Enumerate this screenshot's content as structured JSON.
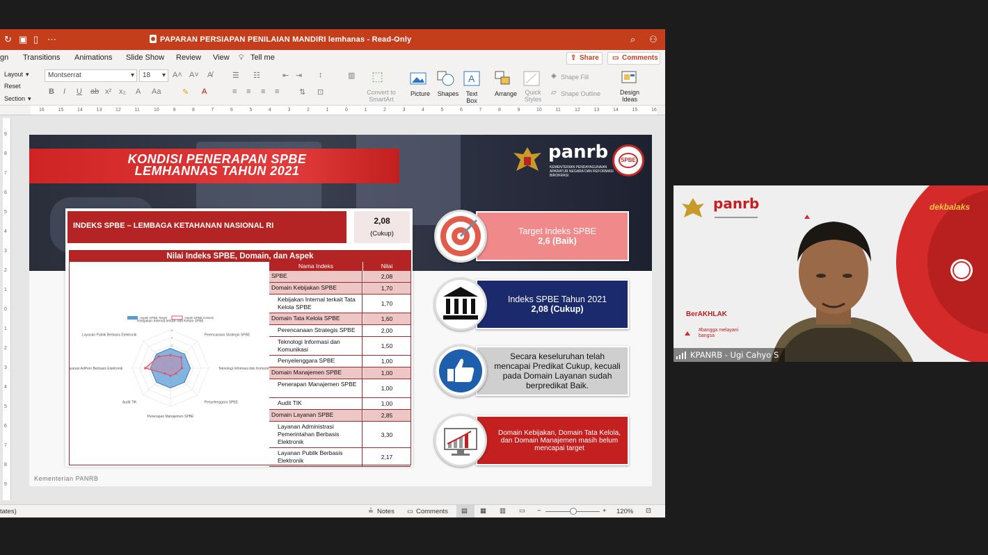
{
  "window": {
    "title": "PAPARAN PERSIAPAN PENILAIAN MANDIRI lemhanas - Read-Only",
    "share_label": "Share",
    "comments_label": "Comments"
  },
  "menu": [
    "gn",
    "Transitions",
    "Animations",
    "Slide Show",
    "Review",
    "View",
    "Tell me"
  ],
  "ribbon": {
    "layout_label": "Layout",
    "reset_label": "Reset",
    "section_label": "Section",
    "font_name": "Montserrat",
    "font_size": "18",
    "convert_label_1": "Convert to",
    "convert_label_2": "SmartArt",
    "picture_label": "Picture",
    "shapes_label": "Shapes",
    "textbox_label_1": "Text",
    "textbox_label_2": "Box",
    "arrange_label": "Arrange",
    "quick_styles_1": "Quick",
    "quick_styles_2": "Styles",
    "shape_fill_label": "Shape Fill",
    "shape_outline_label": "Shape Outline",
    "design_ideas_1": "Design",
    "design_ideas_2": "Ideas"
  },
  "ruler_ticks": [
    "16",
    "15",
    "14",
    "13",
    "12",
    "11",
    "10",
    "9",
    "8",
    "7",
    "6",
    "5",
    "4",
    "3",
    "2",
    "1",
    "0",
    "1",
    "2",
    "3",
    "4",
    "5",
    "6",
    "7",
    "8",
    "9",
    "10",
    "11",
    "12",
    "13",
    "14",
    "15",
    "16"
  ],
  "vruler_ticks": [
    "9",
    "8",
    "7",
    "6",
    "5",
    "4",
    "3",
    "2",
    "1",
    "0",
    "1",
    "2",
    "3",
    "4",
    "5",
    "6",
    "7",
    "8",
    "9"
  ],
  "slide": {
    "title_line1": "KONDISI PENERAPAN SPBE",
    "title_line2": "LEMHANNAS TAHUN 2021",
    "logo_word": "panrb",
    "logo_sub": "KEMENTERIAN PENDAYAGUNAAN APARATUR NEGARA DAN REFORMASI BIROKRASI",
    "seal_text": "SPBE",
    "index_heading": "INDEKS SPBE – LEMBAGA KETAHANAN NASIONAL RI",
    "index_value": "2,08",
    "index_category": "(Cukup)",
    "table_title": "Nilai Indeks SPBE, Domain, dan Aspek",
    "col_name": "Nama Indeks",
    "col_value": "Nilai",
    "rows": [
      {
        "name": "SPBE",
        "value": "2,08",
        "kind": "dom"
      },
      {
        "name": "Domain Kebijakan SPBE",
        "value": "1,70",
        "kind": "dom"
      },
      {
        "name": "Kebijakan Internal terkait Tata Kelola SPBE",
        "value": "1,70",
        "kind": "sub"
      },
      {
        "name": "Domain Tata Kelola SPBE",
        "value": "1,60",
        "kind": "dom"
      },
      {
        "name": "Perencanaan Strategis SPBE",
        "value": "2,00",
        "kind": "sub"
      },
      {
        "name": "Teknologi Informasi dan Komunikasi",
        "value": "1,50",
        "kind": "sub"
      },
      {
        "name": "Penyelenggara SPBE",
        "value": "1,00",
        "kind": "sub"
      },
      {
        "name": "Domain Manajemen SPBE",
        "value": "1,00",
        "kind": "dom"
      },
      {
        "name": "Penerapan Manajemen SPBE",
        "value": "1,00",
        "kind": "sub"
      },
      {
        "name": "Audit TIK",
        "value": "1,00",
        "kind": "sub"
      },
      {
        "name": "Domain Layanan SPBE",
        "value": "2,85",
        "kind": "dom"
      },
      {
        "name": "Layanan Administrasi Pemerintahan Berbasis Elektronik",
        "value": "3,30",
        "kind": "sub"
      },
      {
        "name": "Layanan Publik Berbasis Elektronik",
        "value": "2,17",
        "kind": "sub"
      }
    ],
    "radar": {
      "legend_target": "Aspek SPBE Target",
      "legend_actual": "Aspek SPBE instansi",
      "axes": [
        "Kebijakan Internal terkait Tata Kelola SPBE",
        "Perencanaan Strategis SPBE",
        "Teknologi Informasi dan Komunikasi",
        "Penyelenggara SPBE",
        "Penerapan Manajemen SPBE",
        "Audit TIK",
        "Layanan AdPem Berbasis Elektronik",
        "Layanan Publik Berbasis Elektronik"
      ],
      "target": [
        2.6,
        2.6,
        2.6,
        2.6,
        2.6,
        2.6,
        2.6,
        2.6
      ],
      "actual": [
        1.7,
        2.0,
        1.5,
        1.0,
        1.0,
        1.0,
        3.3,
        2.17
      ],
      "ticks": [
        "5",
        "4",
        "3",
        "2",
        "1",
        "0"
      ]
    },
    "card_target_line1": "Target Indeks SPBE",
    "card_target_line2": "2,6 (Baik)",
    "card_index_line1": "Indeks SPBE Tahun 2021",
    "card_index_line2": "2,08 (Cukup)",
    "card_summary": "Secara keseluruhan telah mencapai Predikat Cukup, kecuali pada Domain Layanan sudah berpredikat Baik.",
    "card_domains": "Domain Kebijakan, Domain Tata Kelola, dan Domain Manajemen masih belum mencapai target",
    "footer": "Kementerian PANRB"
  },
  "status": {
    "left_text": "tates)",
    "notes_label": "Notes",
    "comments_label": "Comments",
    "zoom": "120%"
  },
  "video": {
    "participant": "KPANRB - Ugi Cahyo S",
    "bg_logo": "panrb",
    "bg_brand": "dekbalaks",
    "berakhlak": "BerAKHLAK",
    "tagline": "#bangga melayani bangsa"
  },
  "colors": {
    "ppt_accent": "#c43e1c",
    "slide_red": "#b52424",
    "target_pink": "#f08a8a",
    "navy": "#1a2a6c",
    "card_grey": "#cfcfcf"
  }
}
